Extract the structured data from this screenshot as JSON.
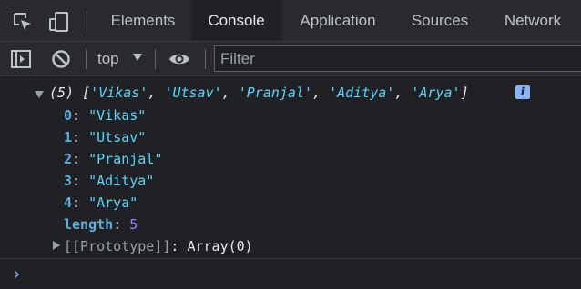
{
  "tabs": [
    {
      "label": "Elements",
      "active": false
    },
    {
      "label": "Console",
      "active": true
    },
    {
      "label": "Application",
      "active": false
    },
    {
      "label": "Sources",
      "active": false
    },
    {
      "label": "Network",
      "active": false
    }
  ],
  "toolbar": {
    "context": "top",
    "filter_placeholder": "Filter"
  },
  "console": {
    "summary_count": "(5)",
    "summary_items": [
      "'Vikas'",
      "'Utsav'",
      "'Pranjal'",
      "'Aditya'",
      "'Arya'"
    ],
    "entries": [
      {
        "key": "0",
        "value": "\"Vikas\""
      },
      {
        "key": "1",
        "value": "\"Utsav\""
      },
      {
        "key": "2",
        "value": "\"Pranjal\""
      },
      {
        "key": "3",
        "value": "\"Aditya\""
      },
      {
        "key": "4",
        "value": "\"Arya\""
      }
    ],
    "length_key": "length",
    "length_value": "5",
    "prototype_key": "[[Prototype]]",
    "prototype_value": "Array(0)",
    "info_glyph": "i",
    "prompt": "›"
  },
  "colors": {
    "background": "#202124",
    "string": "#5cd5fb",
    "key": "#5db0d7",
    "number": "#9980ff",
    "accent": "#8ab4f8"
  }
}
